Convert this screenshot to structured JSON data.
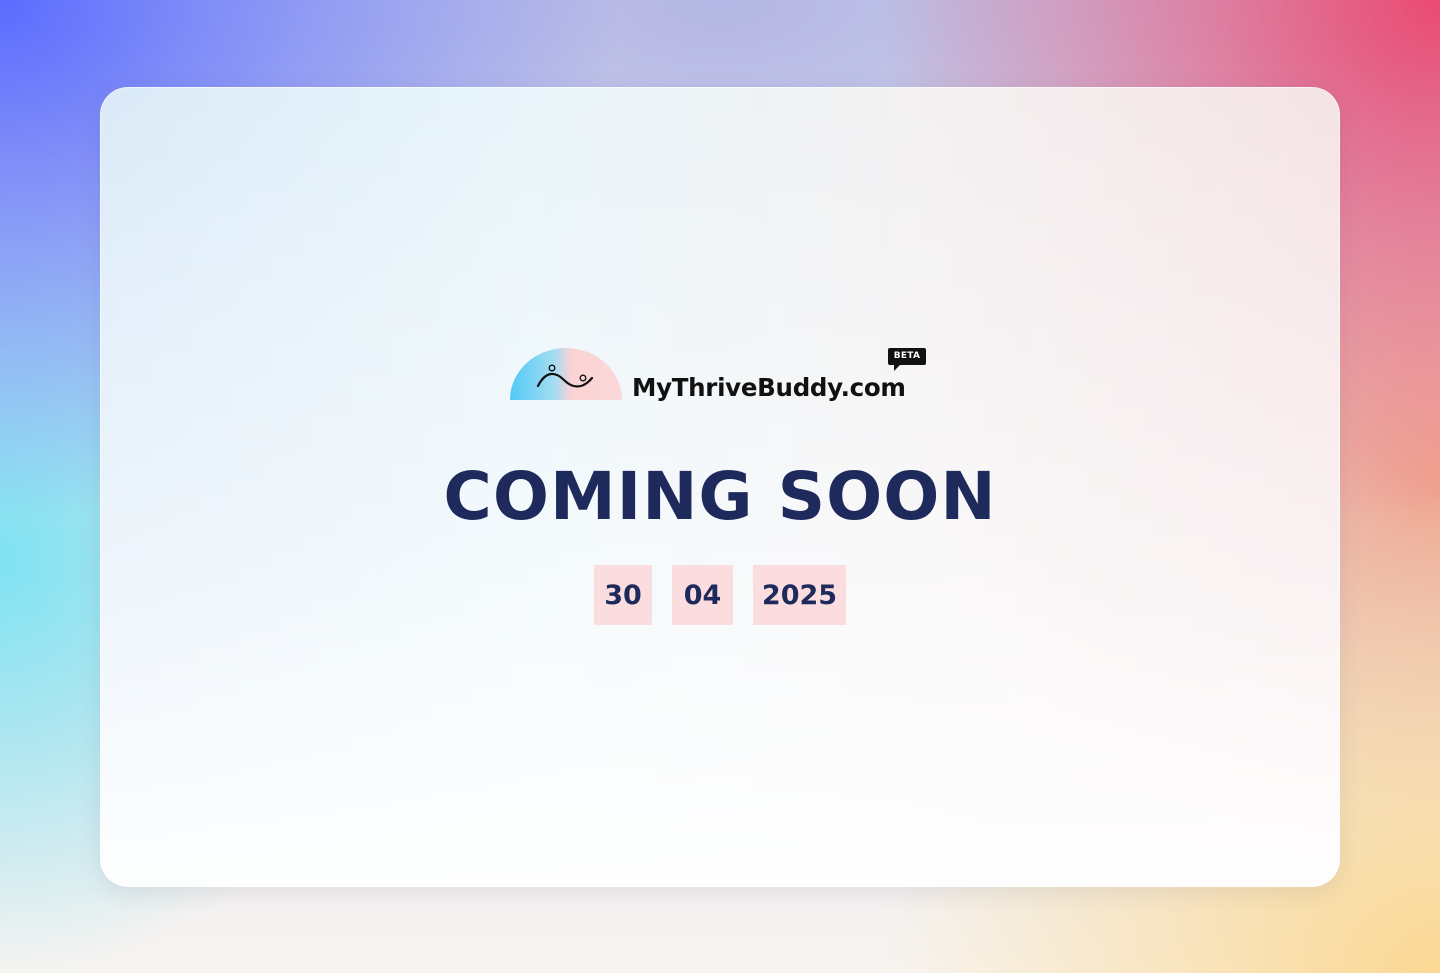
{
  "brand": {
    "name": "MyThriveBuddy.com",
    "badge": "BETA",
    "icon": "rising-sun-logo-icon"
  },
  "headline": "COMING SOON",
  "launch_date": {
    "day": "30",
    "month": "04",
    "year": "2025"
  },
  "colors": {
    "headline": "#1e2a5c",
    "date_box_bg": "#fbdde0",
    "logo_gradient_start": "#58d0f5",
    "logo_gradient_end": "#fbd5d5",
    "brand_text": "#111111"
  }
}
